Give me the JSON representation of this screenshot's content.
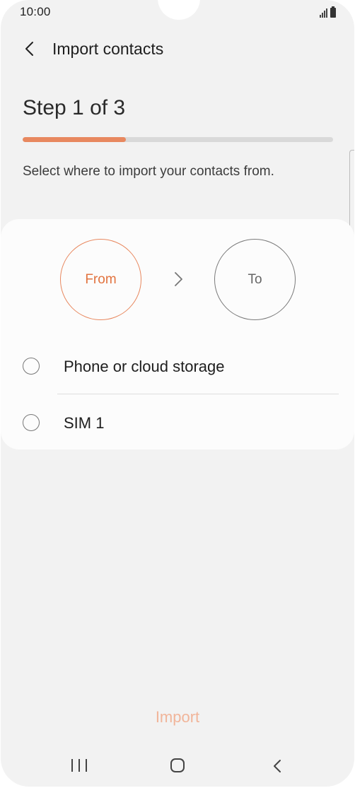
{
  "status_bar": {
    "time": "10:00"
  },
  "header": {
    "title": "Import contacts"
  },
  "step": {
    "label": "Step 1 of 3",
    "progress": 0.333
  },
  "description": "Select where to import your contacts from.",
  "flow": {
    "from_label": "From",
    "to_label": "To"
  },
  "options": [
    {
      "label": "Phone or cloud storage",
      "selected": false
    },
    {
      "label": "SIM 1",
      "selected": false
    }
  ],
  "footer": {
    "import_label": "Import",
    "import_enabled": false
  },
  "colors": {
    "accent": "#e8885f",
    "background": "#f2f2f2",
    "card": "#fcfcfc",
    "disabled_accent": "#f1b59a"
  },
  "icons": {
    "back": "chevron-left-icon",
    "arrow": "chevron-right-icon"
  }
}
